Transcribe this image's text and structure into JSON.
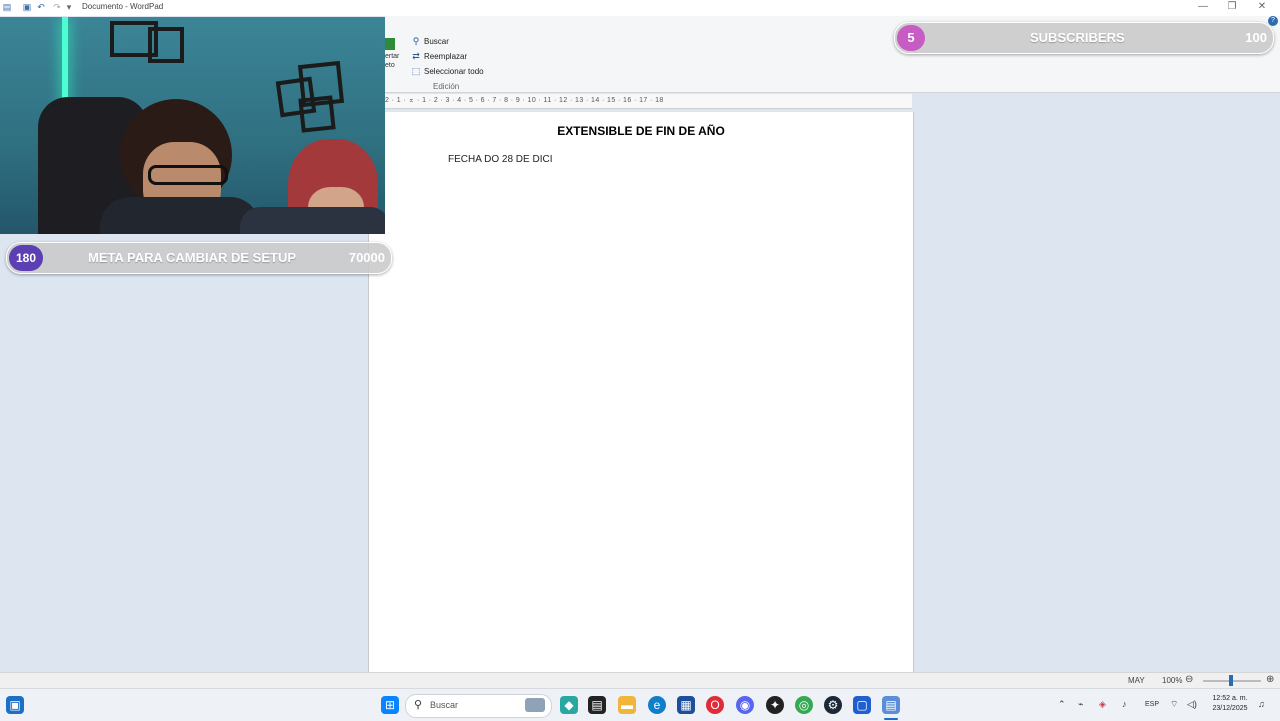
{
  "window": {
    "title": "Documento - WordPad",
    "controls": {
      "minimize": "—",
      "restore": "❐",
      "close": "✕"
    }
  },
  "ribbon": {
    "fragment": "ertar\neto",
    "editing": {
      "find": "Buscar",
      "replace": "Reemplazar",
      "select_all": "Seleccionar todo",
      "group_label": "Edición"
    }
  },
  "ruler": {
    "ticks": "2 · 1 · ⌅ · 1 · 2 · 3 · 4 · 5 · 6 · 7 · 8 · 9 · 10 · 11 · 12 · 13 · 14 · 15 · 16 · 17 · 18"
  },
  "document": {
    "title": "EXTENSIBLE DE FIN DE AÑO",
    "line1": "FECHA DO 28 DE DICI"
  },
  "overlay": {
    "subscribers": {
      "count": "5",
      "label": "SUBSCRIBERS",
      "target": "100",
      "color": "#c65cc4"
    },
    "setup_goal": {
      "count": "180",
      "label": "META PARA CAMBIAR DE SETUP",
      "target": "70000",
      "color": "#5b3fb3"
    }
  },
  "statusbar": {
    "caps": "MAY",
    "zoom": "100%",
    "zoom_out": "⊖",
    "zoom_in": "⊕",
    "zoom_level_fraction": 0.5
  },
  "taskbar": {
    "search_placeholder": "Buscar",
    "clock_time": "12:52 a. m.",
    "clock_date": "23/12/2025",
    "language": "ESP"
  }
}
